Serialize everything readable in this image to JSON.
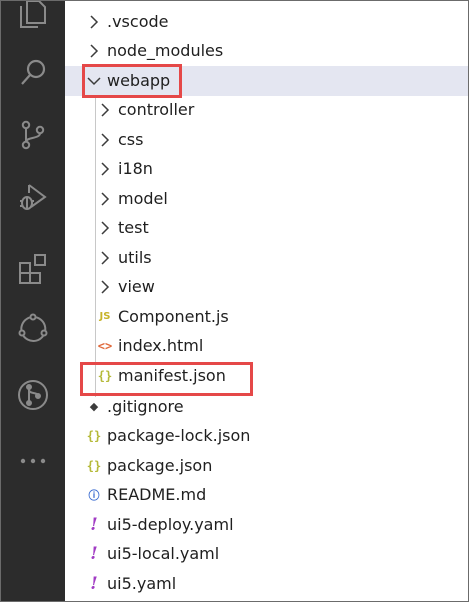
{
  "colors": {
    "activity_bar": "#2c2c2c",
    "activity_icon": "#8a8a8a",
    "selected_row": "#e4e6f1",
    "highlight_box": "#e54848"
  },
  "activity_bar": {
    "icons": [
      "explorer-icon",
      "search-icon",
      "source-control-icon",
      "run-debug-icon",
      "extensions-icon",
      "remote-explorer-icon",
      "git-graph-icon",
      "more-icon"
    ]
  },
  "tree": {
    "items": [
      {
        "label": ".vscode",
        "kind": "folder",
        "expanded": false,
        "depth": 0
      },
      {
        "label": "node_modules",
        "kind": "folder",
        "expanded": false,
        "depth": 0
      },
      {
        "label": "webapp",
        "kind": "folder",
        "expanded": true,
        "depth": 0,
        "selected": true,
        "highlighted": true
      },
      {
        "label": "controller",
        "kind": "folder",
        "expanded": false,
        "depth": 1
      },
      {
        "label": "css",
        "kind": "folder",
        "expanded": false,
        "depth": 1
      },
      {
        "label": "i18n",
        "kind": "folder",
        "expanded": false,
        "depth": 1
      },
      {
        "label": "model",
        "kind": "folder",
        "expanded": false,
        "depth": 1
      },
      {
        "label": "test",
        "kind": "folder",
        "expanded": false,
        "depth": 1
      },
      {
        "label": "utils",
        "kind": "folder",
        "expanded": false,
        "depth": 1
      },
      {
        "label": "view",
        "kind": "folder",
        "expanded": false,
        "depth": 1
      },
      {
        "label": "Component.js",
        "kind": "js",
        "icon_text": "JS",
        "depth": 1
      },
      {
        "label": "index.html",
        "kind": "html",
        "icon_text": "<>",
        "depth": 1
      },
      {
        "label": "manifest.json",
        "kind": "json",
        "icon_text": "{}",
        "depth": 1,
        "highlighted": true
      },
      {
        "label": ".gitignore",
        "kind": "git",
        "icon_text": "◆",
        "depth": 0
      },
      {
        "label": "package-lock.json",
        "kind": "json",
        "icon_text": "{}",
        "depth": 0
      },
      {
        "label": "package.json",
        "kind": "json",
        "icon_text": "{}",
        "depth": 0
      },
      {
        "label": "README.md",
        "kind": "info",
        "icon_text": "ⓘ",
        "depth": 0
      },
      {
        "label": "ui5-deploy.yaml",
        "kind": "yaml",
        "icon_text": "!",
        "depth": 0
      },
      {
        "label": "ui5-local.yaml",
        "kind": "yaml",
        "icon_text": "!",
        "depth": 0
      },
      {
        "label": "ui5.yaml",
        "kind": "yaml",
        "icon_text": "!",
        "depth": 0
      }
    ]
  }
}
